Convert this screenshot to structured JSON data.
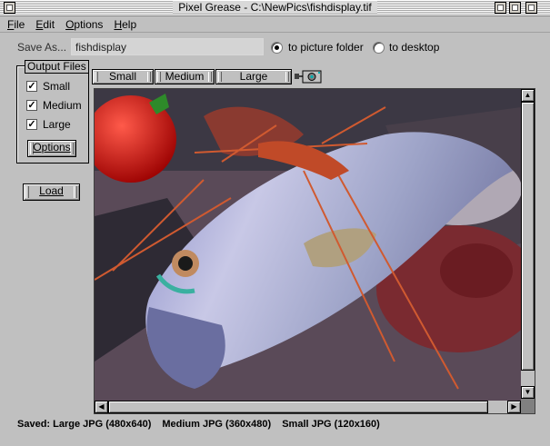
{
  "window": {
    "title": "Pixel Grease - C:\\NewPics\\fishdisplay.tif"
  },
  "menu": {
    "items": [
      {
        "label_first": "F",
        "label_rest": "ile"
      },
      {
        "label_first": "E",
        "label_rest": "dit"
      },
      {
        "label_first": "O",
        "label_rest": "ptions"
      },
      {
        "label_first": "H",
        "label_rest": "elp"
      }
    ]
  },
  "save": {
    "label": "Save As...",
    "value": "fishdisplay",
    "destinations": [
      {
        "label": "to picture folder",
        "selected": true
      },
      {
        "label": "to desktop",
        "selected": false
      }
    ]
  },
  "output_files": {
    "title": "Output Files",
    "items": [
      {
        "label": "Small",
        "checked": true
      },
      {
        "label": "Medium",
        "checked": true
      },
      {
        "label": "Large",
        "checked": true
      }
    ],
    "options_label": "Options"
  },
  "load_label": "Load",
  "size_buttons": [
    "Small",
    "Medium",
    "Large"
  ],
  "check_mark": "✓",
  "status": {
    "parts": [
      "Saved: Large JPG (480x640)",
      "Medium JPG (360x480)",
      "Small JPG (120x160)"
    ]
  },
  "colors": {
    "window_bg": "#c0c0c0",
    "viewport_bg": "#808080"
  }
}
